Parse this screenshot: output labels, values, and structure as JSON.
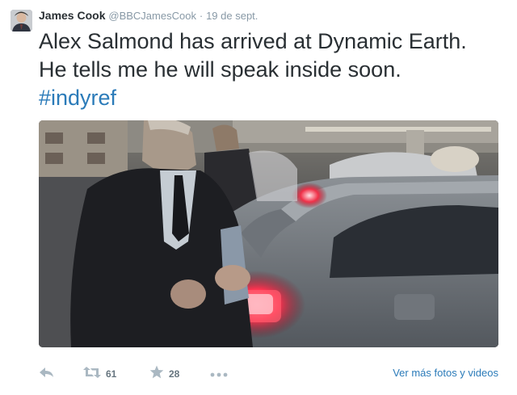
{
  "tweet": {
    "author_name": "James Cook",
    "handle": "@BBCJamesCook",
    "separator": "·",
    "timestamp": "19 de sept.",
    "text_line1": "Alex Salmond has arrived at Dynamic Earth.",
    "text_line2": "He tells me he will speak inside soon.",
    "hashtag": "#indyref"
  },
  "actions": {
    "retweet_count": "61",
    "favorite_count": "28",
    "see_more_label": "Ver más fotos y videos"
  },
  "icons": {
    "reply": "reply-icon",
    "retweet": "retweet-icon",
    "favorite": "star-icon",
    "more": "more-dots-icon"
  },
  "colors": {
    "text": "#292f33",
    "muted": "#8899a6",
    "link": "#2b7bb9",
    "icon": "#aab8c2"
  }
}
